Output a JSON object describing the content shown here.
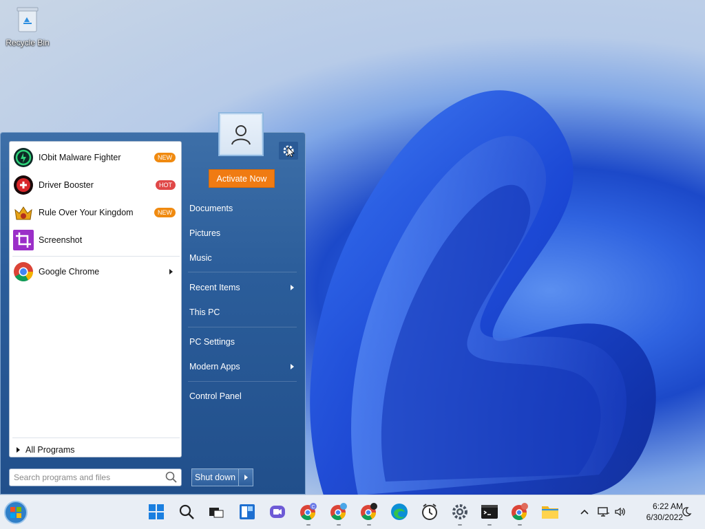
{
  "desktop": {
    "icons": [
      {
        "label": "Recycle Bin",
        "icon": "recycle-bin-icon"
      }
    ]
  },
  "start_menu": {
    "pinned_programs": [
      {
        "name": "IObit Malware Fighter",
        "badge": "NEW",
        "icon": "malware-fighter-icon"
      },
      {
        "name": "Driver Booster",
        "badge": "HOT",
        "icon": "driver-booster-icon"
      },
      {
        "name": "Rule Over Your Kingdom",
        "badge": "NEW",
        "icon": "kingdom-icon"
      },
      {
        "name": "Screenshot",
        "badge": "",
        "icon": "screenshot-icon"
      }
    ],
    "recent_programs": [
      {
        "name": "Google Chrome",
        "icon": "chrome-icon",
        "has_submenu": true
      }
    ],
    "all_programs_label": "All Programs",
    "search_placeholder": "Search programs and files",
    "activate_label": "Activate Now",
    "right_items": [
      {
        "label": "Documents"
      },
      {
        "label": "Pictures"
      },
      {
        "label": "Music"
      },
      {
        "label": "Recent Items"
      },
      {
        "label": "This PC"
      },
      {
        "label": "PC Settings"
      },
      {
        "label": "Modern Apps"
      },
      {
        "label": "Control Panel"
      }
    ],
    "shutdown_label": "Shut down"
  },
  "taskbar": {
    "icons": [
      "start-orb-icon",
      "windows-start-icon",
      "search-icon",
      "task-view-icon",
      "widgets-icon",
      "teams-chat-icon",
      "chrome-c-icon",
      "chrome-profile-icon",
      "chrome-account-icon",
      "edge-icon",
      "clock-app-icon",
      "settings-icon",
      "terminal-icon",
      "chrome-red-icon",
      "file-explorer-icon"
    ],
    "tray": [
      "chevron-up-icon",
      "network-icon",
      "volume-icon"
    ],
    "time": "6:22 AM",
    "date": "6/30/2022"
  },
  "colors": {
    "activate": "#f07b12",
    "badge_new": "#f08a10",
    "badge_hot": "#e04848",
    "menu_blue": "#2b5d9a"
  }
}
